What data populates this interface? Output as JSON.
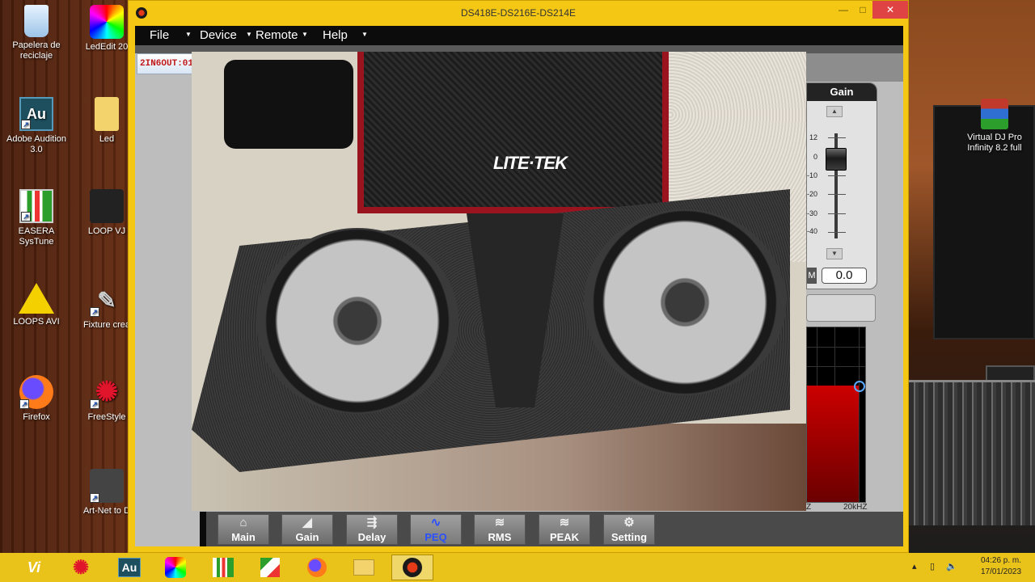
{
  "window": {
    "title": "DS418E-DS216E-DS214E",
    "minimize": "—",
    "maximize": "□",
    "close": "✕"
  },
  "menu": [
    {
      "label": "File"
    },
    {
      "label": "Device"
    },
    {
      "label": "Remote"
    },
    {
      "label": "Help"
    }
  ],
  "io_tab": "2IN6OUT:01",
  "gain": {
    "title": "Gain",
    "scale": [
      "12",
      "0",
      "-10",
      "-20",
      "-30",
      "-40"
    ],
    "mute_label": "M",
    "value": "0.0",
    "level_db": 0
  },
  "eq_graph": {
    "freq_start_label": "Z",
    "freq_end_label": "20kHZ"
  },
  "nav": [
    {
      "label": "Main",
      "icon": "home-icon"
    },
    {
      "label": "Gain",
      "icon": "gain-ramp-icon"
    },
    {
      "label": "Delay",
      "icon": "delay-icon"
    },
    {
      "label": "PEQ",
      "icon": "peq-curve-icon",
      "active": true
    },
    {
      "label": "RMS",
      "icon": "rms-wave-icon"
    },
    {
      "label": "PEAK",
      "icon": "peak-wave-icon"
    },
    {
      "label": "Setting",
      "icon": "gear-icon"
    }
  ],
  "overlay": {
    "brand": "LITE·TEK"
  },
  "desktop_icons": [
    {
      "label": "Papelera de reciclaje",
      "icon": "recycle-bin-icon"
    },
    {
      "label": "LedEdit 20",
      "icon": "ledEdit-icon"
    },
    {
      "label": "Adobe Audition 3.0",
      "icon": "adobe-audition-icon",
      "text": "Au"
    },
    {
      "label": "Led",
      "icon": "folder-icon"
    },
    {
      "label": "EASERA SysTune",
      "icon": "easera-icon"
    },
    {
      "label": "LOOP VJ",
      "icon": "loop-vj-icon"
    },
    {
      "label": "LOOPS AVI",
      "icon": "warning-icon"
    },
    {
      "label": "Fixture crea",
      "icon": "fixture-icon"
    },
    {
      "label": "Firefox",
      "icon": "firefox-icon"
    },
    {
      "label": "FreeStyle",
      "icon": "freestyle-icon"
    },
    {
      "label": "Art-Net to D",
      "icon": "artnet-icon"
    },
    {
      "label": "Virtual DJ Pro Infinity 8.2 full",
      "icon": "winrar-icon"
    }
  ],
  "taskbar": {
    "apps": [
      {
        "icon": "vi-icon",
        "text": "Vi"
      },
      {
        "icon": "freestyle-icon"
      },
      {
        "icon": "adobe-audition-icon",
        "text": "Au"
      },
      {
        "icon": "ledEdit-icon"
      },
      {
        "icon": "easera-icon"
      },
      {
        "icon": "dmx-icon"
      },
      {
        "icon": "firefox-icon"
      },
      {
        "icon": "file-explorer-icon"
      },
      {
        "icon": "ds-dsp-app-icon",
        "active": true
      }
    ],
    "time": "04:26 p. m.",
    "date": "17/01/2023"
  }
}
